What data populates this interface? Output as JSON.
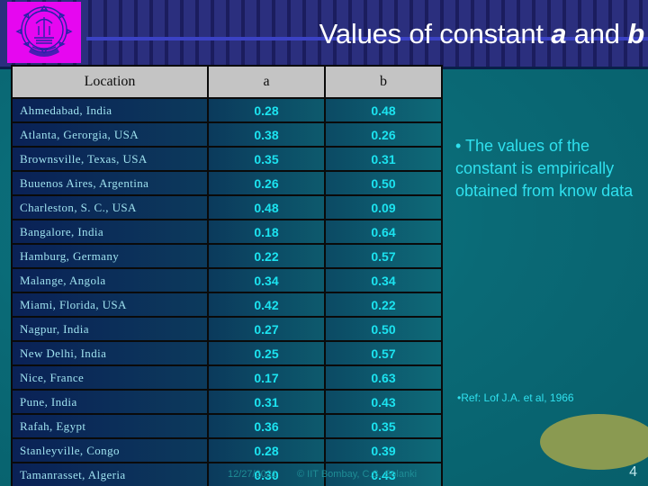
{
  "slide": {
    "title_prefix": "Values of constant ",
    "title_var1": "a",
    "title_mid": " and ",
    "title_var2": "b",
    "page_number": "4",
    "logo_name": "IIT Bombay emblem"
  },
  "table": {
    "headers": [
      "Location",
      "a",
      "b"
    ],
    "rows": [
      {
        "location": "Ahmedabad, India",
        "a": "0.28",
        "b": "0.48"
      },
      {
        "location": "Atlanta, Gerorgia, USA",
        "a": "0.38",
        "b": "0.26"
      },
      {
        "location": "Brownsville, Texas, USA",
        "a": "0.35",
        "b": "0.31"
      },
      {
        "location": "Buuenos Aires, Argentina",
        "a": "0.26",
        "b": "0.50"
      },
      {
        "location": "Charleston, S. C., USA",
        "a": "0.48",
        "b": "0.09"
      },
      {
        "location": "Bangalore, India",
        "a": "0.18",
        "b": "0.64"
      },
      {
        "location": "Hamburg, Germany",
        "a": "0.22",
        "b": "0.57"
      },
      {
        "location": "Malange, Angola",
        "a": "0.34",
        "b": "0.34"
      },
      {
        "location": "Miami, Florida, USA",
        "a": "0.42",
        "b": "0.22"
      },
      {
        "location": "Nagpur, India",
        "a": "0.27",
        "b": "0.50"
      },
      {
        "location": "New Delhi, India",
        "a": "0.25",
        "b": "0.57"
      },
      {
        "location": "Nice, France",
        "a": "0.17",
        "b": "0.63"
      },
      {
        "location": "Pune, India",
        "a": "0.31",
        "b": "0.43"
      },
      {
        "location": "Rafah, Egypt",
        "a": "0.36",
        "b": "0.35"
      },
      {
        "location": "Stanleyville, Congo",
        "a": "0.28",
        "b": "0.39"
      },
      {
        "location": "Tamanrasset, Algeria",
        "a": "0.30",
        "b": "0.43"
      }
    ]
  },
  "notes": {
    "bullet": "• The values of the constant is empirically obtained from know data",
    "reference": "•Ref: Lof J.A. et al, 1966"
  },
  "footer": {
    "date": "12/27/2021",
    "credit": "© IIT Bombay, C.S. Solanki"
  },
  "chart_data": {
    "type": "table",
    "title": "Values of constant a and b",
    "columns": [
      "Location",
      "a",
      "b"
    ],
    "categories": [
      "Ahmedabad, India",
      "Atlanta, Gerorgia, USA",
      "Brownsville, Texas, USA",
      "Buuenos Aires, Argentina",
      "Charleston, S. C., USA",
      "Bangalore, India",
      "Hamburg, Germany",
      "Malange, Angola",
      "Miami, Florida, USA",
      "Nagpur, India",
      "New Delhi, India",
      "Nice, France",
      "Pune, India",
      "Rafah, Egypt",
      "Stanleyville, Congo",
      "Tamanrasset, Algeria"
    ],
    "series": [
      {
        "name": "a",
        "values": [
          0.28,
          0.38,
          0.35,
          0.26,
          0.48,
          0.18,
          0.22,
          0.34,
          0.42,
          0.27,
          0.25,
          0.17,
          0.31,
          0.36,
          0.28,
          0.3
        ]
      },
      {
        "name": "b",
        "values": [
          0.48,
          0.26,
          0.31,
          0.5,
          0.09,
          0.64,
          0.57,
          0.34,
          0.22,
          0.5,
          0.57,
          0.63,
          0.43,
          0.35,
          0.39,
          0.43
        ]
      }
    ],
    "annotations": [
      "•Ref: Lof J.A. et al, 1966"
    ]
  },
  "colors": {
    "background_teal": "#0d6b77",
    "banner_navy": "#2b2f7e",
    "header_gray": "#c4c4c4",
    "value_cyan": "#1ce3f0",
    "logo_magenta": "#e607f0",
    "accent_olive": "#8a9a51"
  }
}
